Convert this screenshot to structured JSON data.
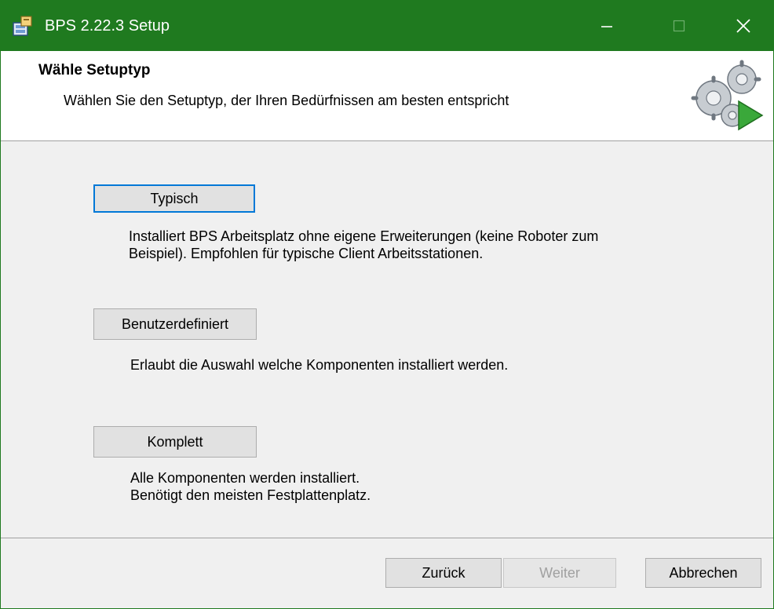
{
  "window": {
    "title": "BPS 2.22.3 Setup",
    "accent_color": "#1f7a1f",
    "controls": {
      "minimize_icon": "minimize-icon",
      "maximize_icon": "maximize-icon",
      "close_icon": "close-icon"
    }
  },
  "header": {
    "title": "Wähle Setuptyp",
    "subtitle": "Wählen Sie den Setuptyp, der Ihren Bedürfnissen am besten entspricht",
    "icon": "gears-play-icon"
  },
  "options": [
    {
      "button_label": "Typisch",
      "description_lines": [
        "Installiert BPS Arbeitsplatz ohne eigene Erweiterungen (keine Roboter zum",
        "Beispiel). Empfohlen für typische Client Arbeitsstationen."
      ]
    },
    {
      "button_label": "Benutzerdefiniert",
      "description_lines": [
        "Erlaubt die Auswahl welche Komponenten installiert werden."
      ]
    },
    {
      "button_label": "Komplett",
      "description_lines": [
        "Alle Komponenten werden installiert.",
        "Benötigt den meisten Festplattenplatz."
      ]
    }
  ],
  "footer": {
    "back_label": "Zurück",
    "next_label": "Weiter",
    "cancel_label": "Abbrechen"
  }
}
